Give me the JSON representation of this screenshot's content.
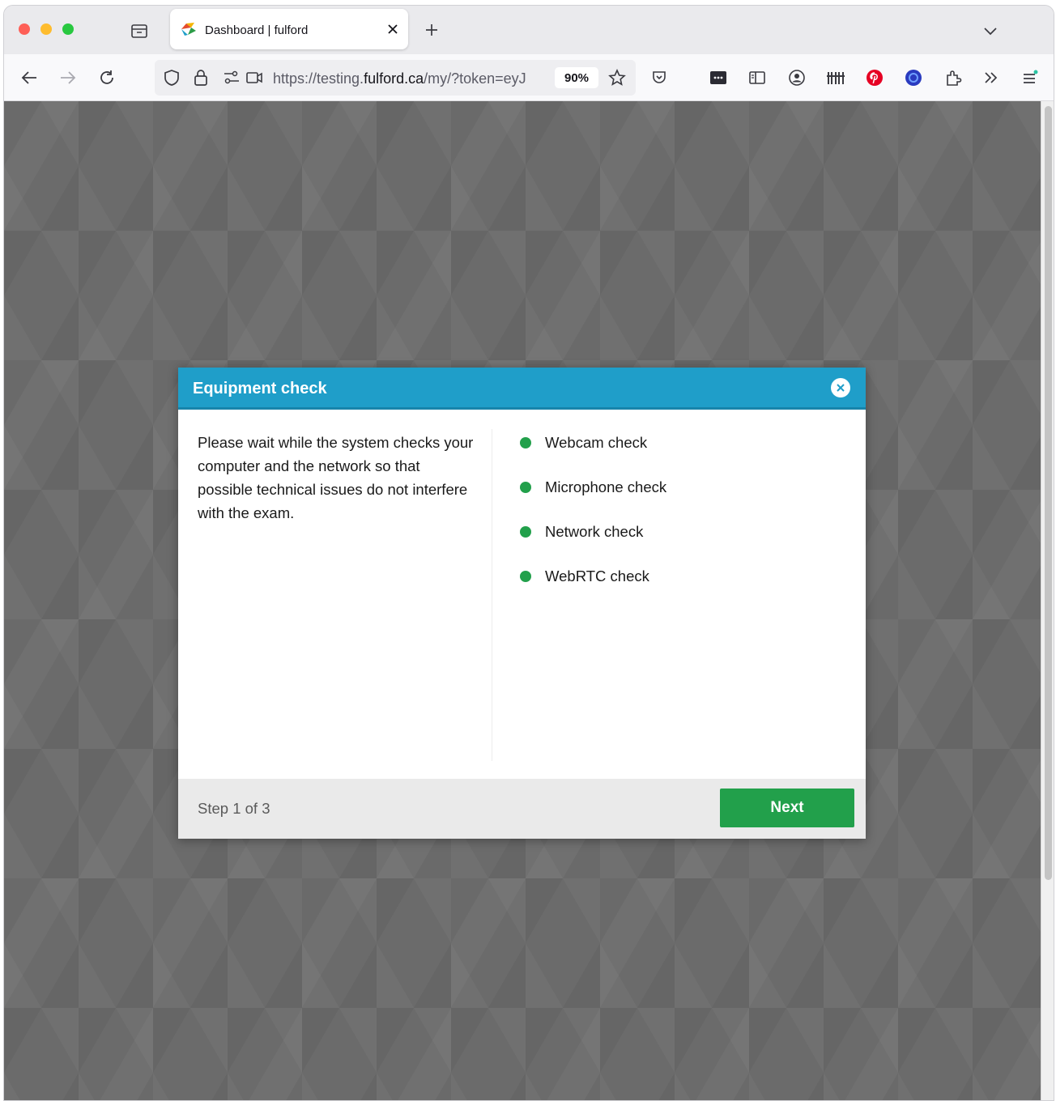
{
  "browser": {
    "tab": {
      "title": "Dashboard | fulford"
    },
    "url": {
      "prefix": "https://testing.",
      "domain": "fulford.ca",
      "path": "/my/?token=eyJ"
    },
    "zoom": "90%"
  },
  "modal": {
    "title": "Equipment check",
    "description": "Please wait while the system checks your computer and the network so that possible technical issues do not interfere with the exam.",
    "checks": [
      {
        "label": "Webcam check",
        "status": "ok"
      },
      {
        "label": "Microphone check",
        "status": "ok"
      },
      {
        "label": "Network check",
        "status": "ok"
      },
      {
        "label": "WebRTC check",
        "status": "ok"
      }
    ],
    "step": "Step 1 of 3",
    "next_label": "Next"
  },
  "colors": {
    "header": "#1f9ec9",
    "success": "#22a04b",
    "backdrop": "#6b6b6b"
  }
}
